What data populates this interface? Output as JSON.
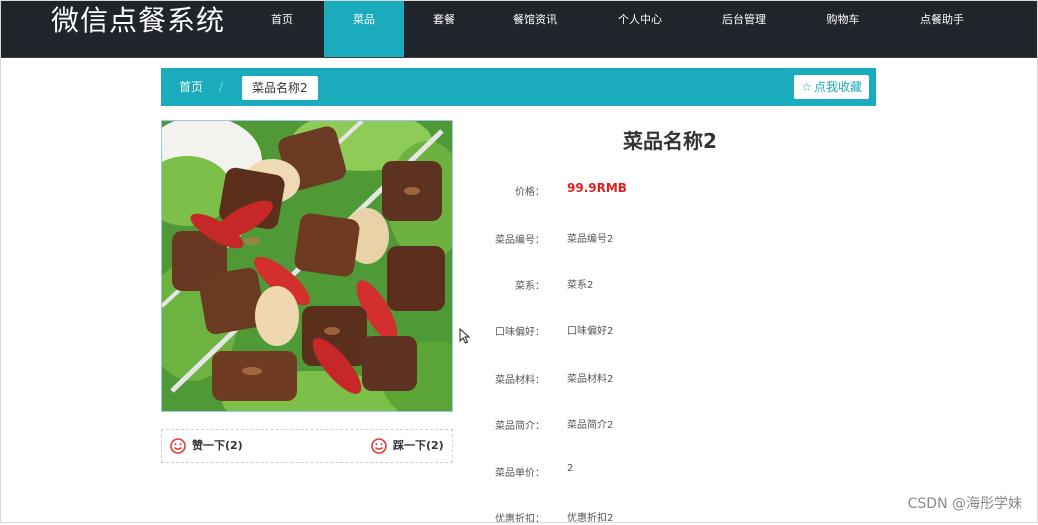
{
  "brand": "微信点餐系统",
  "nav": [
    {
      "label": "首页"
    },
    {
      "label": "菜品",
      "active": true
    },
    {
      "label": "套餐"
    },
    {
      "label": "餐馆资讯"
    },
    {
      "label": "个人中心"
    },
    {
      "label": "后台管理"
    },
    {
      "label": "购物车"
    },
    {
      "label": "点餐助手"
    }
  ],
  "breadcrumb": {
    "home": "首页",
    "separator": "/",
    "current": "菜品名称2",
    "favorite_label": "点我收藏",
    "favorite_icon": "star-outline-icon"
  },
  "detail": {
    "title": "菜品名称2",
    "fields": [
      {
        "label": "价格：",
        "value": "99.9RMB"
      },
      {
        "label": "菜品编号：",
        "value": "菜品编号2"
      },
      {
        "label": "菜系：",
        "value": "菜系2"
      },
      {
        "label": "口味偏好：",
        "value": "口味偏好2"
      },
      {
        "label": "菜品材料：",
        "value": "菜品材料2"
      },
      {
        "label": "菜品简介：",
        "value": "菜品简介2"
      },
      {
        "label": "菜品单价：",
        "value": "2"
      },
      {
        "label": "优惠折扣：",
        "value": "优惠折扣2"
      }
    ]
  },
  "votes": {
    "like_label": "赞一下(2)",
    "dislike_label": "踩一下(2)",
    "icon": "smiley-icon"
  },
  "colors": {
    "nav_bg": "#20252c",
    "accent": "#1aacbd",
    "price": "#e02020"
  },
  "watermark": "CSDN @海彤学妹"
}
